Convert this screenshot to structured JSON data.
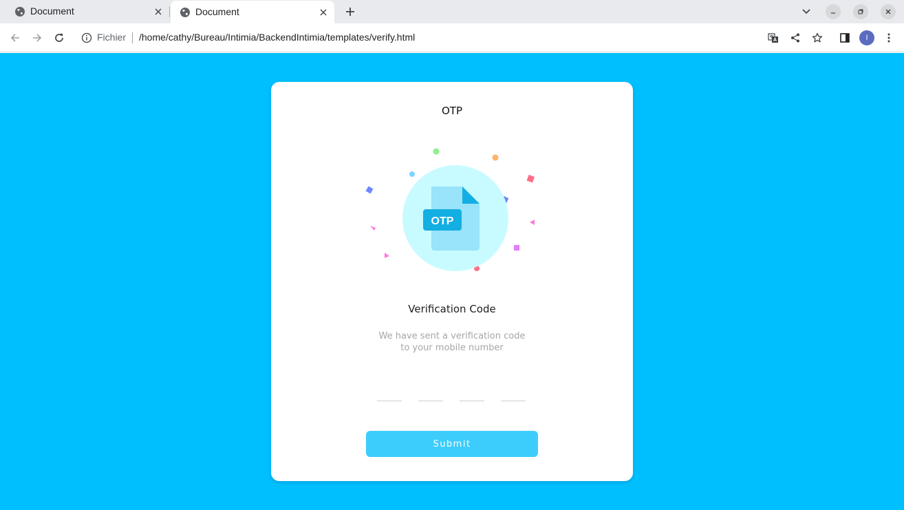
{
  "browser": {
    "tabs": [
      {
        "title": "Document",
        "icon": "globe-icon",
        "active": false
      },
      {
        "title": "Document",
        "icon": "globe-icon",
        "active": true
      }
    ],
    "address": {
      "scheme_label": "Fichier",
      "url": "/home/cathy/Bureau/Intimia/BackendIntimia/templates/verify.html"
    },
    "profile_initial": "I"
  },
  "page": {
    "background": "#00bfff",
    "card": {
      "title": "OTP",
      "badge_text": "OTP",
      "heading": "Verification Code",
      "subtext_line1": "We have sent a verification code",
      "subtext_line2": "to your mobile number",
      "otp_fields": [
        "",
        "",
        "",
        ""
      ],
      "submit_label": "Submit"
    },
    "colors": {
      "accent": "#3dcdfc",
      "circle": "#c8fbff",
      "document": "#99e3fb",
      "badge": "#13aee2"
    }
  }
}
